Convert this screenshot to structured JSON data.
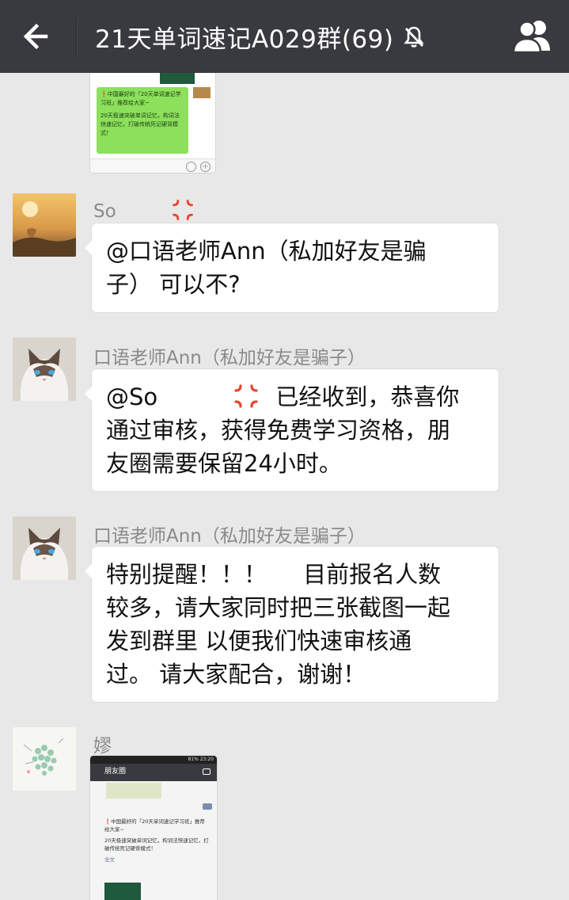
{
  "header": {
    "title": "21天单词速记A029群(69)",
    "back_icon": "arrow-left-icon",
    "mute_icon": "bell-muted-icon",
    "members_icon": "group-members-icon"
  },
  "messages": [
    {
      "type": "image",
      "thumb": {
        "line1": "❗中国最好的「20天单词速记学习班」推荐给大家~",
        "line2": "20天极速突破单词记忆，构词法快速记忆，打破传统死记硬背模式！"
      }
    },
    {
      "type": "text",
      "sender": "So",
      "sender_emoji": "angry-emoji",
      "lines": [
        "@口语老师Ann（私加好友是骗",
        "子） 可以不?"
      ]
    },
    {
      "type": "text",
      "sender": "口语老师Ann（私加好友是骗子）",
      "mention": "@So",
      "after_mention": "已经收到，恭喜你",
      "lines": [
        "通过审核，获得免费学习资格，朋",
        "友圈需要保留24小时。"
      ]
    },
    {
      "type": "text",
      "sender": "口语老师Ann（私加好友是骗子）",
      "lines": [
        "特别提醒！！！     目前报名人数",
        "较多，请大家同时把三张截图一起",
        "发到群里 以便我们快速审核通",
        "过。 请大家配合，谢谢！"
      ]
    },
    {
      "type": "image",
      "sender": "嫪",
      "thumb": {
        "header": "朋友圈",
        "status": "81% 23:20",
        "line1": "❗中国最好的「20天单词速记学习班」推荐给大家~",
        "line2": "20天极速突破单词记忆，构词法快速记忆，打破传统死记硬背模式！",
        "footer": "全文"
      }
    }
  ],
  "colors": {
    "topbar": "#393a3f",
    "background": "#e8e8e8",
    "bubble": "#ffffff",
    "sender_name": "#8a8a8a",
    "wechat_green": "#8ce05b"
  }
}
